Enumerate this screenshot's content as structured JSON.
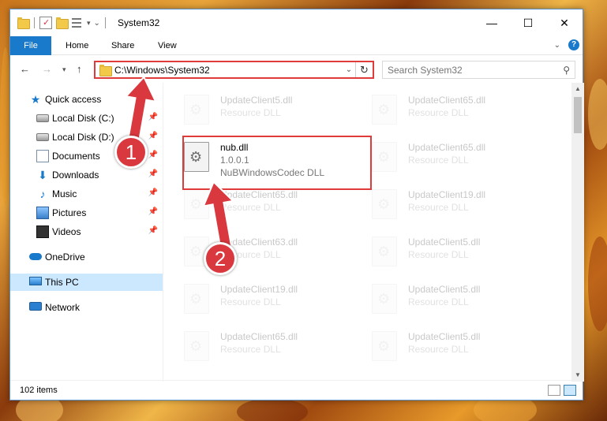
{
  "window": {
    "title": "System32",
    "minimize": "—",
    "maximize": "☐",
    "close": "✕"
  },
  "ribbon": {
    "tabs": [
      "File",
      "Home",
      "Share",
      "View"
    ]
  },
  "address_bar": {
    "path": "C:\\Windows\\System32",
    "search_placeholder": "Search System32"
  },
  "sidebar": {
    "items": [
      {
        "label": "Quick access",
        "icon": "star-icon",
        "pinned": false
      },
      {
        "label": "Local Disk (C:)",
        "icon": "drive-icon",
        "pinned": true
      },
      {
        "label": "Local Disk (D:)",
        "icon": "drive-icon",
        "pinned": true
      },
      {
        "label": "Documents",
        "icon": "documents-icon",
        "pinned": true
      },
      {
        "label": "Downloads",
        "icon": "download-icon",
        "pinned": true
      },
      {
        "label": "Music",
        "icon": "music-icon",
        "pinned": true
      },
      {
        "label": "Pictures",
        "icon": "pictures-icon",
        "pinned": true
      },
      {
        "label": "Videos",
        "icon": "videos-icon",
        "pinned": true
      },
      {
        "label": "OneDrive",
        "icon": "onedrive-icon",
        "pinned": false
      },
      {
        "label": "This PC",
        "icon": "this-pc-icon",
        "pinned": false,
        "selected": true
      },
      {
        "label": "Network",
        "icon": "network-icon",
        "pinned": false
      }
    ]
  },
  "files": {
    "highlighted": {
      "name": "nub.dll",
      "version": "1.0.0.1",
      "description": "NuBWindowsCodec DLL"
    },
    "left_column": [
      {
        "name": "UpdateClient5.dll",
        "description": "Resource DLL"
      },
      {
        "name": "UpdateClient65.dll",
        "description": "Resource DLL"
      },
      {
        "name": "UpdateClient63.dll",
        "description": "Resource DLL"
      },
      {
        "name": "UpdateClient19.dll",
        "description": "Resource DLL"
      },
      {
        "name": "UpdateClient65.dll",
        "description": "Resource DLL"
      }
    ],
    "right_column": [
      {
        "name": "UpdateClient65.dll",
        "description": "Resource DLL"
      },
      {
        "name": "UpdateClient65.dll",
        "description": "Resource DLL"
      },
      {
        "name": "UpdateClient19.dll",
        "description": "Resource DLL"
      },
      {
        "name": "UpdateClient5.dll",
        "description": "Resource DLL"
      },
      {
        "name": "UpdateClient5.dll",
        "description": "Resource DLL"
      },
      {
        "name": "UpdateClient5.dll",
        "description": "Resource DLL"
      }
    ]
  },
  "status": {
    "item_count": "102 items"
  },
  "annotations": {
    "step1": "1",
    "step2": "2",
    "highlight_color": "#e03b3b"
  }
}
